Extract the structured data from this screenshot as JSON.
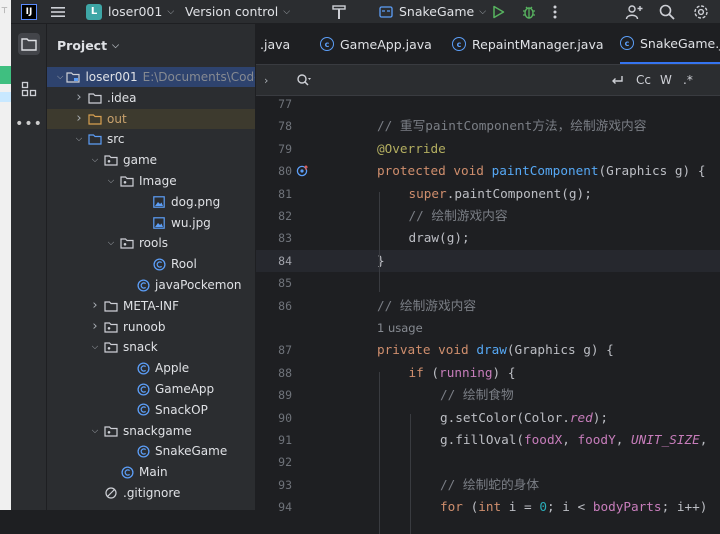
{
  "titlebar": {
    "project_badge": "L",
    "project_name": "loser001",
    "vcs": "Version control",
    "run_config": "SnakeGame"
  },
  "project_panel": {
    "title": "Project",
    "tree": [
      {
        "label": "loser001",
        "path": "E:\\Documents\\Code",
        "icon": "module-icon",
        "arrow": "down",
        "level": 0,
        "selected": true
      },
      {
        "label": ".idea",
        "icon": "folder-icon",
        "arrow": "right",
        "level": 1
      },
      {
        "label": "out",
        "icon": "excluded-folder-icon",
        "arrow": "right",
        "level": 1,
        "excluded": true
      },
      {
        "label": "src",
        "icon": "source-folder-icon",
        "arrow": "down",
        "level": 1
      },
      {
        "label": "game",
        "icon": "package-icon",
        "arrow": "down",
        "level": 2
      },
      {
        "label": "Image",
        "icon": "package-icon",
        "arrow": "down",
        "level": 3
      },
      {
        "label": "dog.png",
        "icon": "image-file-icon",
        "level": 5
      },
      {
        "label": "wu.jpg",
        "icon": "image-file-icon",
        "level": 5
      },
      {
        "label": "rools",
        "icon": "package-icon",
        "arrow": "down",
        "level": 3
      },
      {
        "label": "Rool",
        "icon": "class-icon",
        "level": 5
      },
      {
        "label": "javaPockemon",
        "icon": "class-icon",
        "level": 4
      },
      {
        "label": "META-INF",
        "icon": "folder-icon",
        "arrow": "right",
        "level": 2
      },
      {
        "label": "runoob",
        "icon": "package-icon",
        "arrow": "right",
        "level": 2
      },
      {
        "label": "snack",
        "icon": "package-icon",
        "arrow": "down",
        "level": 2
      },
      {
        "label": "Apple",
        "icon": "class-icon",
        "level": 4
      },
      {
        "label": "GameApp",
        "icon": "class-icon",
        "level": 4
      },
      {
        "label": "SnackOP",
        "icon": "class-icon",
        "level": 4
      },
      {
        "label": "snackgame",
        "icon": "package-icon",
        "arrow": "down",
        "level": 2
      },
      {
        "label": "SnakeGame",
        "icon": "class-icon",
        "level": 4
      },
      {
        "label": "Main",
        "icon": "class-icon",
        "level": 3
      },
      {
        "label": ".gitignore",
        "icon": "ignore-file-icon",
        "level": 2
      }
    ]
  },
  "editor": {
    "tabs": [
      {
        "label": ".java",
        "icon": null,
        "active": false
      },
      {
        "label": "GameApp.java",
        "icon": "java-class-icon",
        "active": false
      },
      {
        "label": "RepaintManager.java",
        "icon": "java-class-icon",
        "active": false
      },
      {
        "label": "SnakeGame.java",
        "icon": "java-class-icon",
        "active": true
      }
    ],
    "find": {
      "match_case": "Cc",
      "words": "W",
      "regex": ".*"
    },
    "current_line": "84",
    "usage_hint": "1 usage",
    "lines": [
      {
        "n": "77",
        "parts": []
      },
      {
        "n": "78",
        "parts": [
          {
            "t": "// 重写paintComponent方法，绘制游戏内容",
            "c": "cm"
          }
        ],
        "indent": 1
      },
      {
        "n": "79",
        "parts": [
          {
            "t": "@Override",
            "c": "an"
          }
        ],
        "indent": 1
      },
      {
        "n": "80",
        "parts": [
          {
            "t": "protected void ",
            "c": "kw"
          },
          {
            "t": "paintComponent",
            "c": "fn"
          },
          {
            "t": "(Graphics g) {",
            "c": ""
          }
        ],
        "indent": 1
      },
      {
        "n": "81",
        "parts": [
          {
            "t": "super",
            "c": "kw"
          },
          {
            "t": ".paintComponent(g);",
            "c": ""
          }
        ],
        "indent": 2
      },
      {
        "n": "82",
        "parts": [
          {
            "t": "// 绘制游戏内容",
            "c": "cm"
          }
        ],
        "indent": 2
      },
      {
        "n": "83",
        "parts": [
          {
            "t": "draw(g);",
            "c": ""
          }
        ],
        "indent": 2
      },
      {
        "n": "84",
        "parts": [
          {
            "t": "}",
            "c": ""
          }
        ],
        "indent": 1
      },
      {
        "n": "85",
        "parts": []
      },
      {
        "n": "86",
        "parts": [
          {
            "t": "// 绘制游戏内容",
            "c": "cm"
          }
        ],
        "indent": 1
      },
      {
        "n": "87",
        "parts": [
          {
            "t": "private void ",
            "c": "kw"
          },
          {
            "t": "draw",
            "c": "fn"
          },
          {
            "t": "(Graphics g) {",
            "c": ""
          }
        ],
        "indent": 1
      },
      {
        "n": "88",
        "parts": [
          {
            "t": "if ",
            "c": "kw"
          },
          {
            "t": "(",
            "c": ""
          },
          {
            "t": "running",
            "c": "fld"
          },
          {
            "t": ") {",
            "c": ""
          }
        ],
        "indent": 2
      },
      {
        "n": "89",
        "parts": [
          {
            "t": "// 绘制食物",
            "c": "cm"
          }
        ],
        "indent": 3
      },
      {
        "n": "90",
        "parts": [
          {
            "t": "g.setColor(Color.",
            "c": ""
          },
          {
            "t": "red",
            "c": "itf"
          },
          {
            "t": ");",
            "c": ""
          }
        ],
        "indent": 3
      },
      {
        "n": "91",
        "parts": [
          {
            "t": "g.fillOval(",
            "c": ""
          },
          {
            "t": "foodX",
            "c": "fld"
          },
          {
            "t": ", ",
            "c": ""
          },
          {
            "t": "foodY",
            "c": "fld"
          },
          {
            "t": ", ",
            "c": ""
          },
          {
            "t": "UNIT_SIZE",
            "c": "itf"
          },
          {
            "t": ",",
            "c": ""
          }
        ],
        "indent": 3
      },
      {
        "n": "92",
        "parts": []
      },
      {
        "n": "93",
        "parts": [
          {
            "t": "// 绘制蛇的身体",
            "c": "cm"
          }
        ],
        "indent": 3
      },
      {
        "n": "94",
        "parts": [
          {
            "t": "for ",
            "c": "kw"
          },
          {
            "t": "(",
            "c": ""
          },
          {
            "t": "int ",
            "c": "kw"
          },
          {
            "t": "i = ",
            "c": ""
          },
          {
            "t": "0",
            "c": "num"
          },
          {
            "t": "; i < ",
            "c": ""
          },
          {
            "t": "bodyParts",
            "c": "fld"
          },
          {
            "t": "; i++)",
            "c": ""
          }
        ],
        "indent": 3
      }
    ]
  }
}
